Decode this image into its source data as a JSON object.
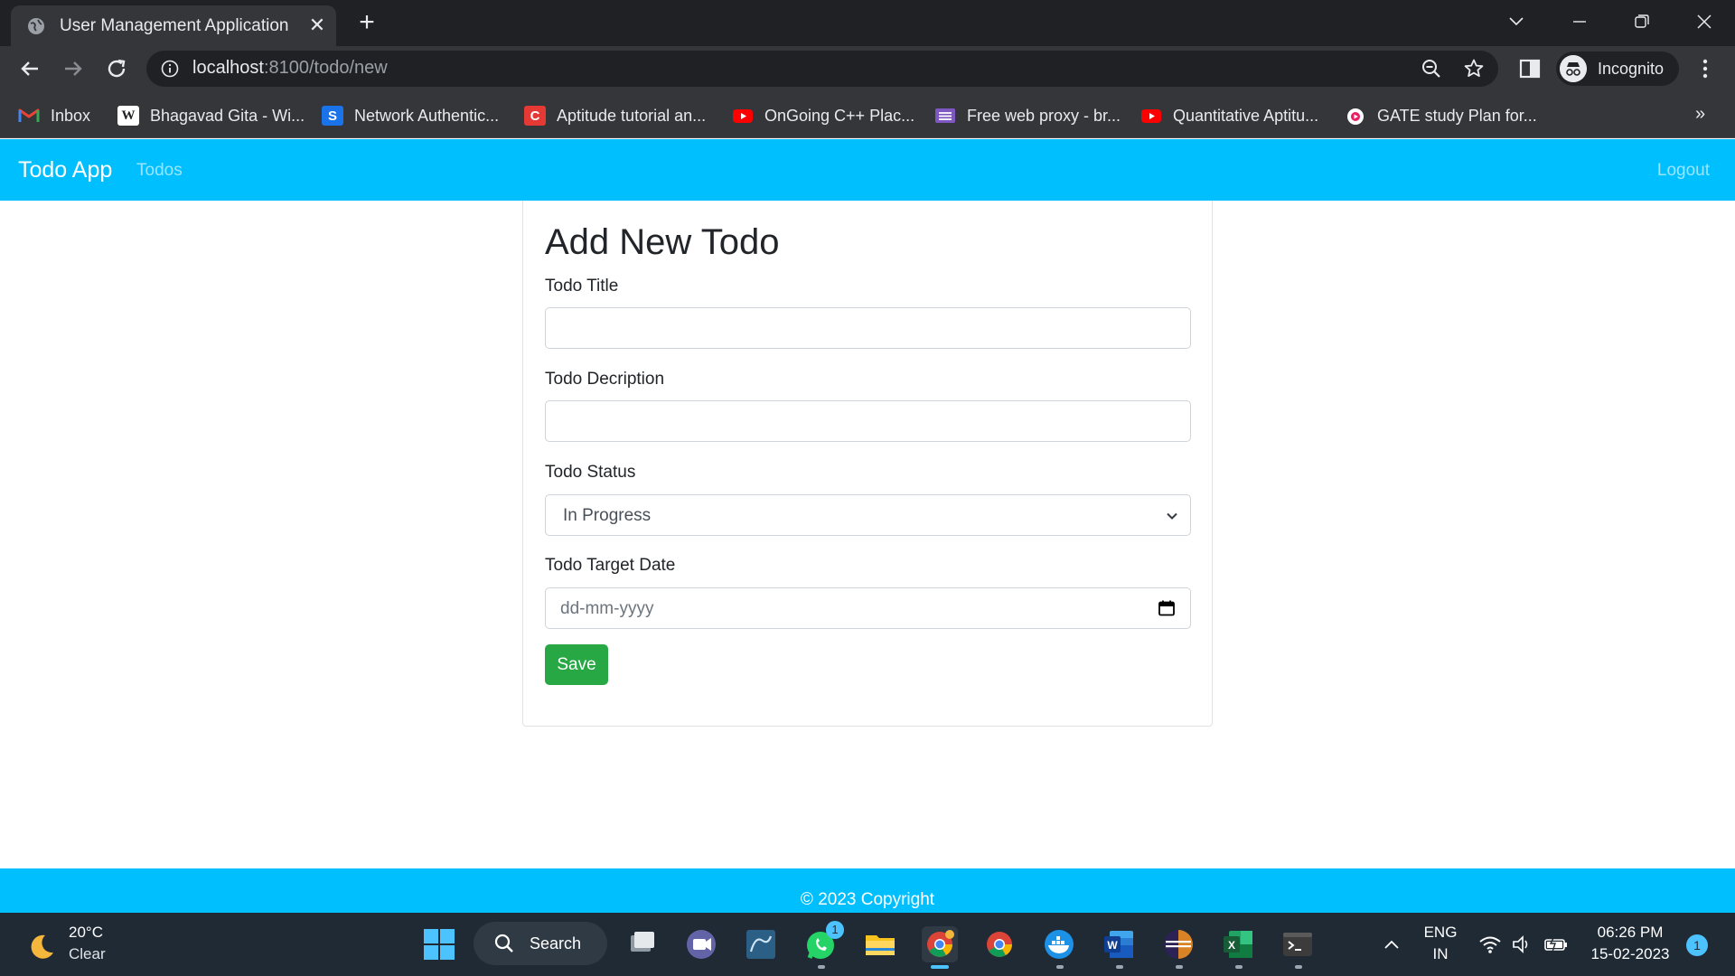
{
  "browser": {
    "tab_title": "User Management Application",
    "url_host": "localhost",
    "url_path": ":8100/todo/new",
    "profile_label": "Incognito",
    "bookmarks": [
      {
        "label": "Inbox",
        "icon": "gmail-icon"
      },
      {
        "label": "Bhagavad Gita - Wi...",
        "icon": "wikipedia-icon"
      },
      {
        "label": "Network Authentic...",
        "icon": "s-icon"
      },
      {
        "label": "Aptitude tutorial an...",
        "icon": "c-icon"
      },
      {
        "label": "OnGoing C++ Plac...",
        "icon": "youtube-icon"
      },
      {
        "label": "Free web proxy - br...",
        "icon": "proxy-icon"
      },
      {
        "label": "Quantitative Aptitu...",
        "icon": "youtube-icon"
      },
      {
        "label": "GATE study Plan for...",
        "icon": "media-icon"
      }
    ],
    "more_bookmarks": "»"
  },
  "app": {
    "brand": "Todo App",
    "nav_todos": "Todos",
    "logout": "Logout"
  },
  "form": {
    "heading": "Add New Todo",
    "title_label": "Todo Title",
    "title_value": "",
    "description_label": "Todo Decription",
    "description_value": "",
    "status_label": "Todo Status",
    "status_selected": "In Progress",
    "date_label": "Todo Target Date",
    "date_placeholder": "dd-mm-yyyy",
    "save_label": "Save"
  },
  "footer": {
    "copyright": "© 2023 Copyright"
  },
  "taskbar": {
    "temperature": "20°C",
    "condition": "Clear",
    "search_label": "Search",
    "whatsapp_badge": "1",
    "lang_top": "ENG",
    "lang_bottom": "IN",
    "time": "06:26 PM",
    "date": "15-02-2023",
    "notification_count": "1"
  },
  "colors": {
    "navbar": "#00bfff",
    "save_button": "#28a745",
    "chrome_dark": "#202124",
    "chrome_toolbar": "#35363a",
    "taskbar": "#1f2a35"
  }
}
